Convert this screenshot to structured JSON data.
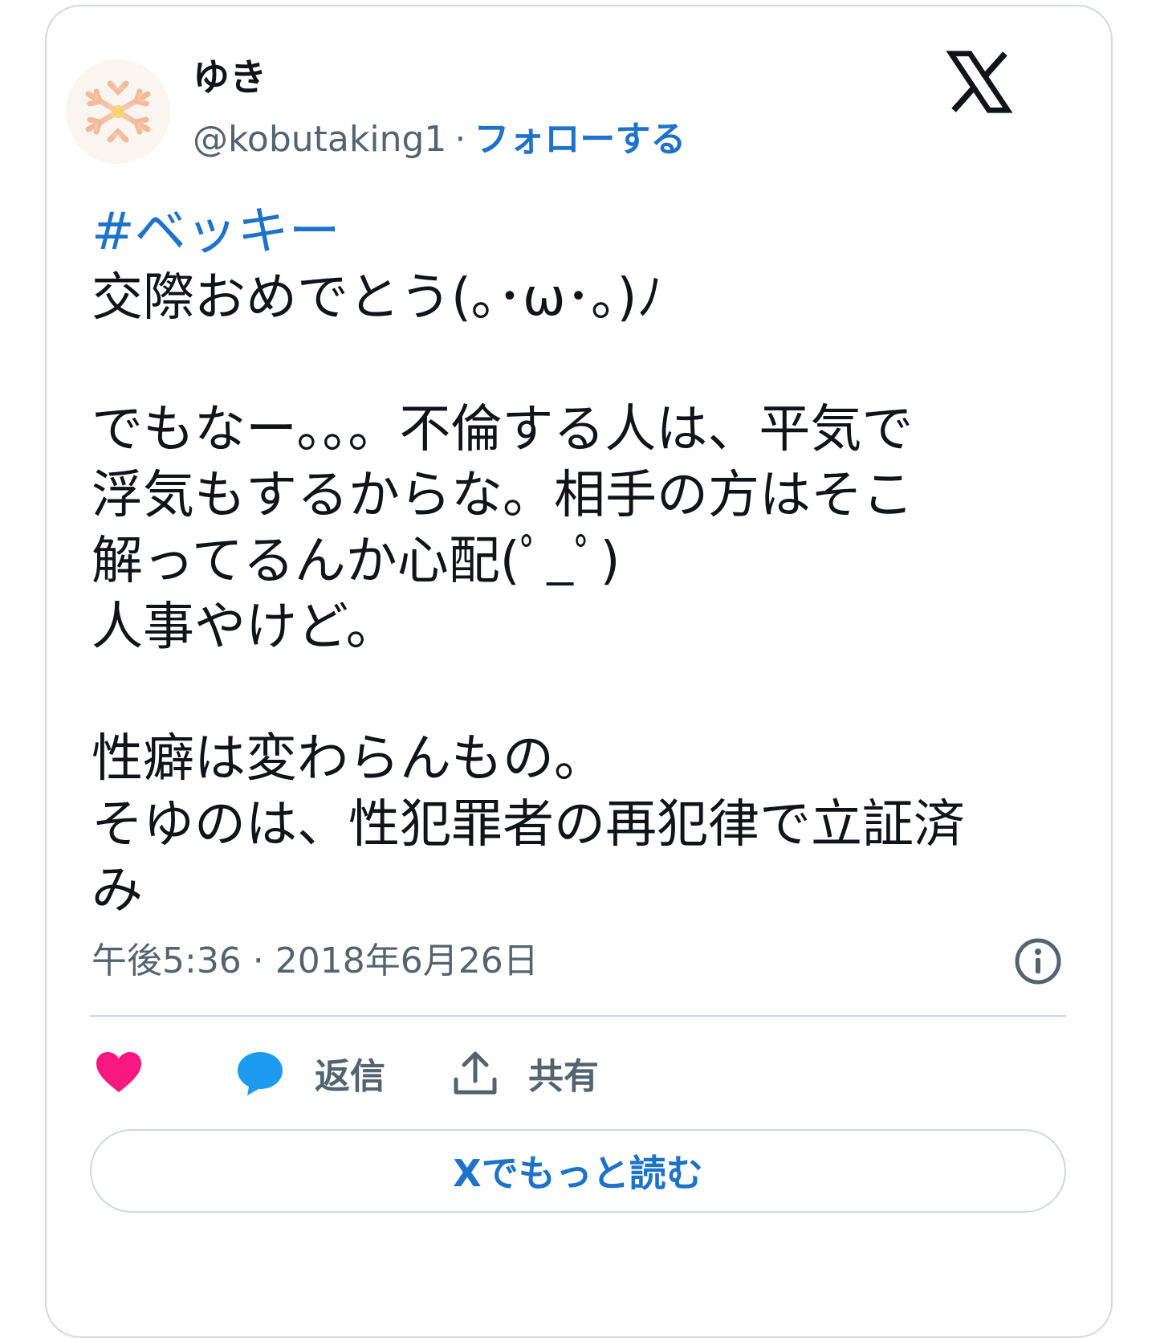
{
  "tweet": {
    "author": {
      "name": "ゆき",
      "handle": "@kobutaking1",
      "separator": "·",
      "follow_label": "フォローする",
      "avatar_icon": "snowflake-icon"
    },
    "brand_logo": "x-logo-icon",
    "body_lines": [
      "#ベッキー",
      "交際おめでとう(｡･ω･｡)ﾉ",
      "",
      "でもなー。。。不倫する人は、平気で",
      "浮気もするからな。相手の方はそこ",
      "解ってるんか心配(ﾟ_ﾟ)",
      "人事やけど。",
      "",
      "性癖は変わらんもの。",
      "そゆのは、性犯罪者の再犯律で立証済",
      "み"
    ],
    "timestamp": "午後5:36 · 2018年6月26日",
    "actions": {
      "like_icon": "heart-icon",
      "reply_icon": "speech-bubble-icon",
      "reply_label": "返信",
      "share_icon": "share-upload-icon",
      "share_label": "共有"
    },
    "read_more_label": "Xでもっと読む"
  },
  "colors": {
    "link_blue": "#1d73c9",
    "secondary_text": "#536471",
    "like_pink": "#f91880",
    "reply_blue": "#1d9bf0",
    "border": "#cfd9de"
  }
}
